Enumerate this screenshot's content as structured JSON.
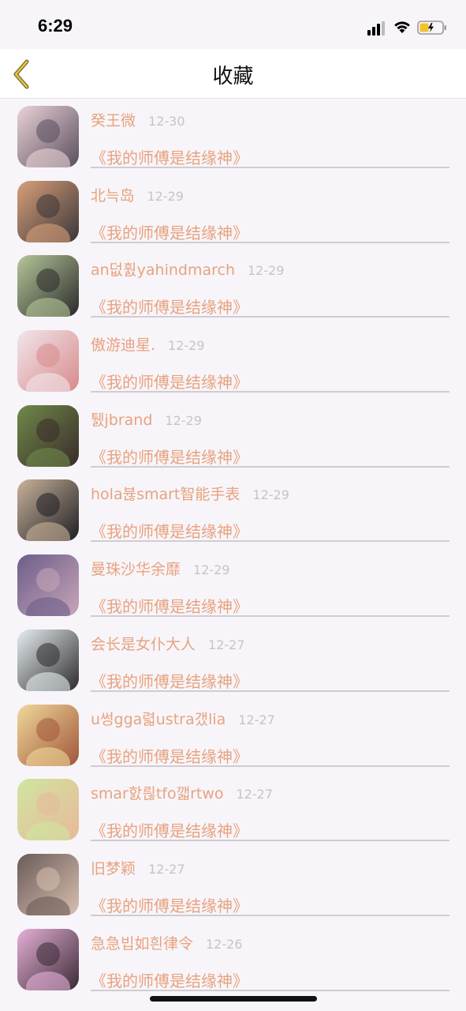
{
  "status_bar": {
    "time": "6:29"
  },
  "header": {
    "title": "收藏"
  },
  "favorites": [
    {
      "user": "癸王微",
      "date": "12-30",
      "book": "《我的师傅是结缘神》",
      "avatar_colors": [
        "#e9d3d6",
        "#5a4d5e"
      ]
    },
    {
      "user": "北늑岛",
      "date": "12-29",
      "book": "《我的师傅是结缘神》",
      "avatar_colors": [
        "#d8a07a",
        "#3a3538"
      ]
    },
    {
      "user": "an덦훬yahindmarch",
      "date": "12-29",
      "book": "《我的师傅是结缘神》",
      "avatar_colors": [
        "#b6c79a",
        "#2a2a2a"
      ]
    },
    {
      "user": "傲游迪星.",
      "date": "12-29",
      "book": "《我的师傅是结缘神》",
      "avatar_colors": [
        "#f1e6ec",
        "#d88a8a"
      ]
    },
    {
      "user": "퉰jbrand",
      "date": "12-29",
      "book": "《我的师傅是结缘神》",
      "avatar_colors": [
        "#6f8a4a",
        "#3a2a2a"
      ]
    },
    {
      "user": "hola뷶smart智能手表",
      "date": "12-29",
      "book": "《我的师傅是结缘神》",
      "avatar_colors": [
        "#c9b39a",
        "#1e1e24"
      ]
    },
    {
      "user": "曼珠沙华余靡",
      "date": "12-29",
      "book": "《我的师傅是结缘神》",
      "avatar_colors": [
        "#6b5d8a",
        "#c9a6b8"
      ]
    },
    {
      "user": "会长是女仆大人",
      "date": "12-27",
      "book": "《我的师傅是结缘神》",
      "avatar_colors": [
        "#e6eef0",
        "#2c2a2e"
      ]
    },
    {
      "user": "u썽gga렯ustra갰lia",
      "date": "12-27",
      "book": "《我的师傅是结缘神》",
      "avatar_colors": [
        "#f0d99a",
        "#a0553a"
      ]
    },
    {
      "user": "smar핤릖tfo깳rtwo",
      "date": "12-27",
      "book": "《我的师傅是结缘神》",
      "avatar_colors": [
        "#cfe6a0",
        "#e8b89a"
      ]
    },
    {
      "user": "旧梦颖",
      "date": "12-27",
      "book": "《我的师傅是结缘神》",
      "avatar_colors": [
        "#6a5a58",
        "#d8c0b0"
      ]
    },
    {
      "user": "急急빕如흰律令",
      "date": "12-26",
      "book": "《我的师傅是结缘神》",
      "avatar_colors": [
        "#e6b0d8",
        "#3a2a34"
      ]
    }
  ]
}
